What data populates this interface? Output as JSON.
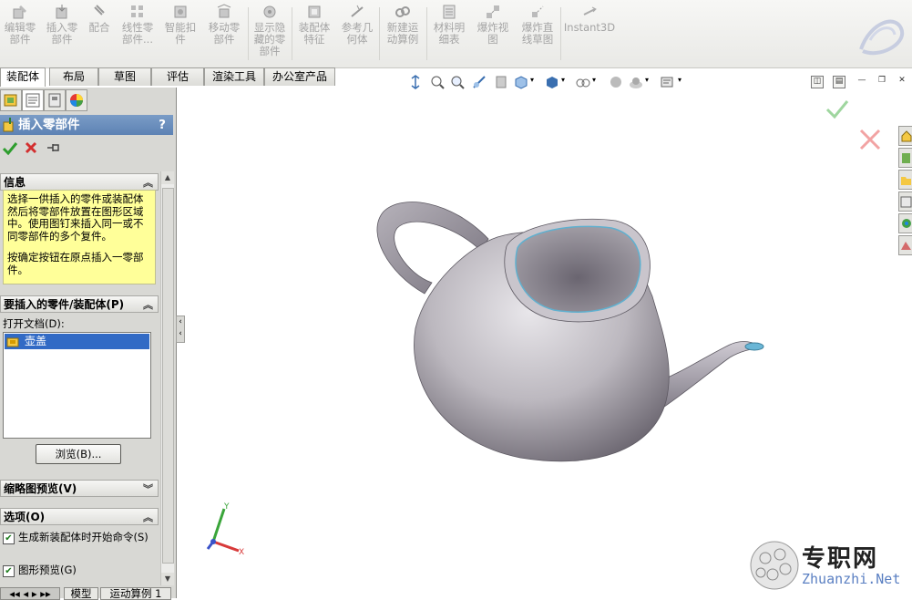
{
  "ribbon": {
    "buttons": [
      {
        "label": "编辑零部件",
        "icon": "edit-component-icon"
      },
      {
        "label": "插入零部件",
        "icon": "insert-component-icon"
      },
      {
        "label": "配合",
        "icon": "mate-icon"
      },
      {
        "label": "线性零部件...",
        "icon": "linear-pattern-icon"
      },
      {
        "label": "智能扣件",
        "icon": "smart-fasteners-icon"
      },
      {
        "label": "移动零部件",
        "icon": "move-component-icon"
      },
      {
        "label": "显示隐藏的零部件",
        "icon": "show-hidden-icon"
      },
      {
        "label": "装配体特征",
        "icon": "assembly-features-icon"
      },
      {
        "label": "参考几何体",
        "icon": "reference-geometry-icon"
      },
      {
        "label": "新建运动算例",
        "icon": "new-motion-study-icon"
      },
      {
        "label": "材料明细表",
        "icon": "bom-icon"
      },
      {
        "label": "爆炸视图",
        "icon": "exploded-view-icon"
      },
      {
        "label": "爆炸直线草图",
        "icon": "explode-line-sketch-icon"
      },
      {
        "label": "Instant3D",
        "icon": "instant3d-icon"
      }
    ]
  },
  "tabs": [
    {
      "label": "装配体",
      "active": true
    },
    {
      "label": "布局"
    },
    {
      "label": "草图"
    },
    {
      "label": "评估"
    },
    {
      "label": "渲染工具"
    },
    {
      "label": "办公室产品"
    }
  ],
  "panel": {
    "title": "插入零部件",
    "help": "?",
    "info_header": "信息",
    "info_text_1": "选择一供插入的零件或装配体然后将零部件放置在图形区域中。使用图钉来插入同一或不同零部件的多个复件。",
    "info_text_2": "按确定按钮在原点插入一零部件。",
    "parts_header": "要插入的零件/装配体(P)",
    "open_doc_label": "打开文档(D):",
    "open_doc_item": "壶盖",
    "browse_label": "浏览(B)...",
    "thumb_header": "缩略图预览(V)",
    "options_header": "选项(O)",
    "option_1": "生成新装配体时开始命令(S)",
    "option_1_checked": true,
    "option_2": "图形预览(G)",
    "option_2_checked": true
  },
  "bottom_tabs": [
    "模型",
    "运动算例 1"
  ],
  "triad": {
    "x": "X",
    "y": "Y"
  },
  "watermark": {
    "brand": "专职网",
    "url": "Zhuanzhi.Net"
  },
  "colors": {
    "accent_blue": "#316ac5",
    "info_yellow": "#ffff99",
    "ok_green": "#4caf50",
    "cancel_red": "#e53935"
  }
}
